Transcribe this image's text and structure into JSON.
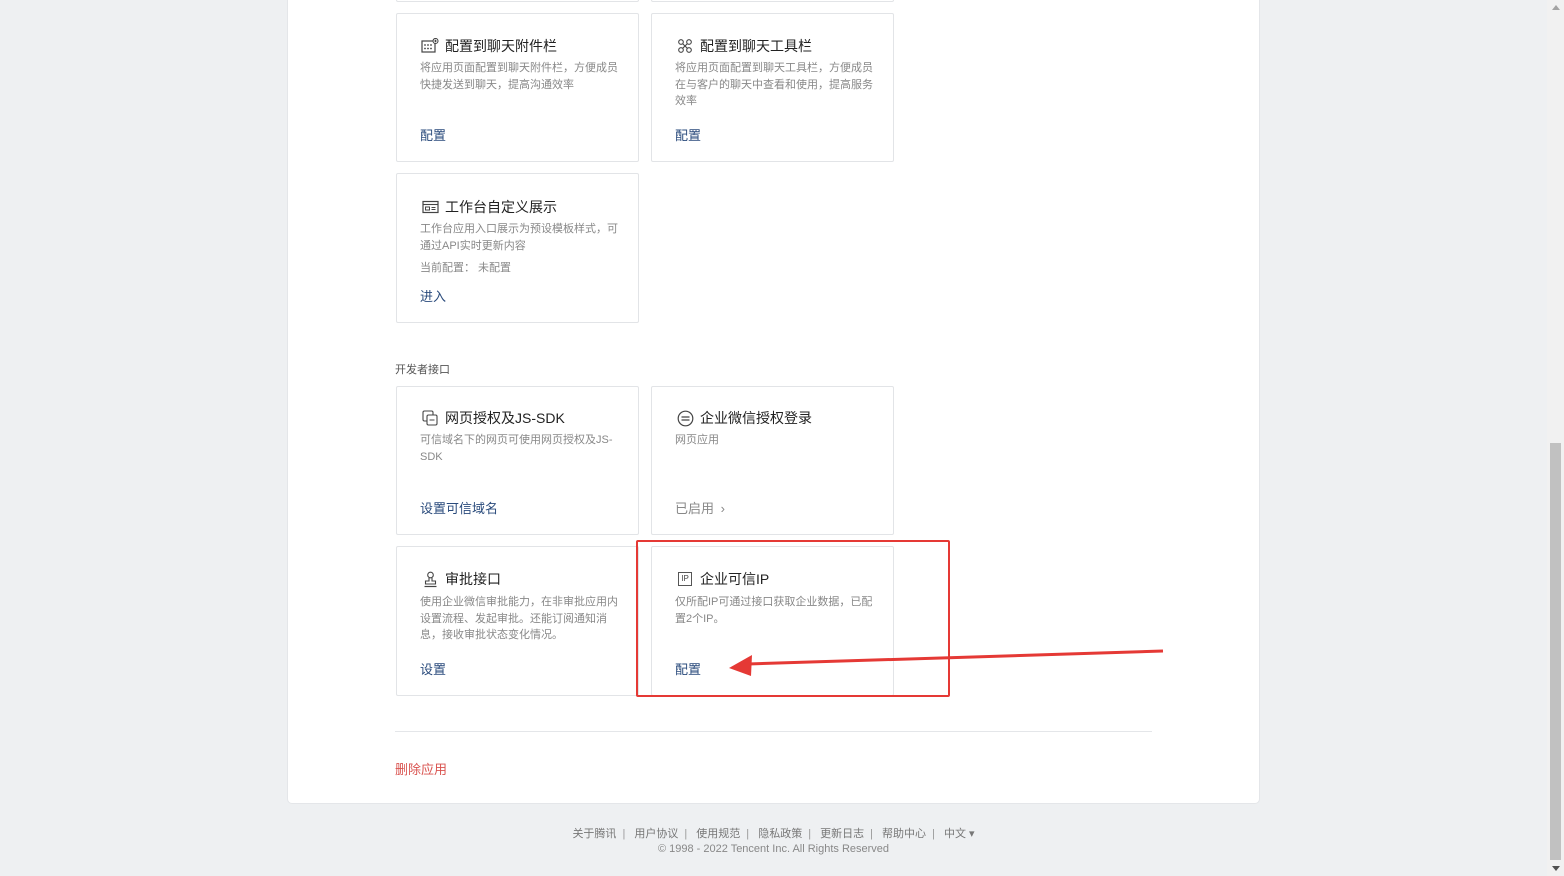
{
  "cards": {
    "chat_attach": {
      "title": "配置到聊天附件栏",
      "desc": "将应用页面配置到聊天附件栏，方便成员快捷发送到聊天，提高沟通效率",
      "link": "配置"
    },
    "chat_toolbar": {
      "title": "配置到聊天工具栏",
      "desc": "将应用页面配置到聊天工具栏，方便成员在与客户的聊天中查看和使用，提高服务效率",
      "link": "配置"
    },
    "workbench": {
      "title": "工作台自定义展示",
      "desc": "工作台应用入口展示为预设模板样式，可通过API实时更新内容",
      "current_config": "当前配置： 未配置",
      "link": "进入"
    },
    "web_auth": {
      "title": "网页授权及JS-SDK",
      "desc": "可信域名下的网页可使用网页授权及JS-SDK",
      "link": "设置可信域名"
    },
    "wecom_login": {
      "title": "企业微信授权登录",
      "desc": "网页应用",
      "link": "已启用",
      "link_chevron": "›"
    },
    "approval": {
      "title": "审批接口",
      "desc": "使用企业微信审批能力，在非审批应用内设置流程、发起审批。还能订阅通知消息，接收审批状态变化情况。",
      "link": "设置"
    },
    "trusted_ip": {
      "title": "企业可信IP",
      "desc": "仅所配IP可通过接口获取企业数据，已配置2个IP。",
      "link": "配置",
      "icon_text": "IP"
    }
  },
  "section": {
    "developer_api": "开发者接口"
  },
  "delete_app": "删除应用",
  "footer": {
    "links": [
      "关于腾讯",
      "用户协议",
      "使用规范",
      "隐私政策",
      "更新日志",
      "帮助中心"
    ],
    "language": "中文",
    "language_caret": "▾",
    "copyright": "© 1998 - 2022 Tencent Inc. All Rights Reserved"
  },
  "annotation_color": "#e53935",
  "link_color": "#2a4b7c",
  "danger_color": "#d9534f"
}
